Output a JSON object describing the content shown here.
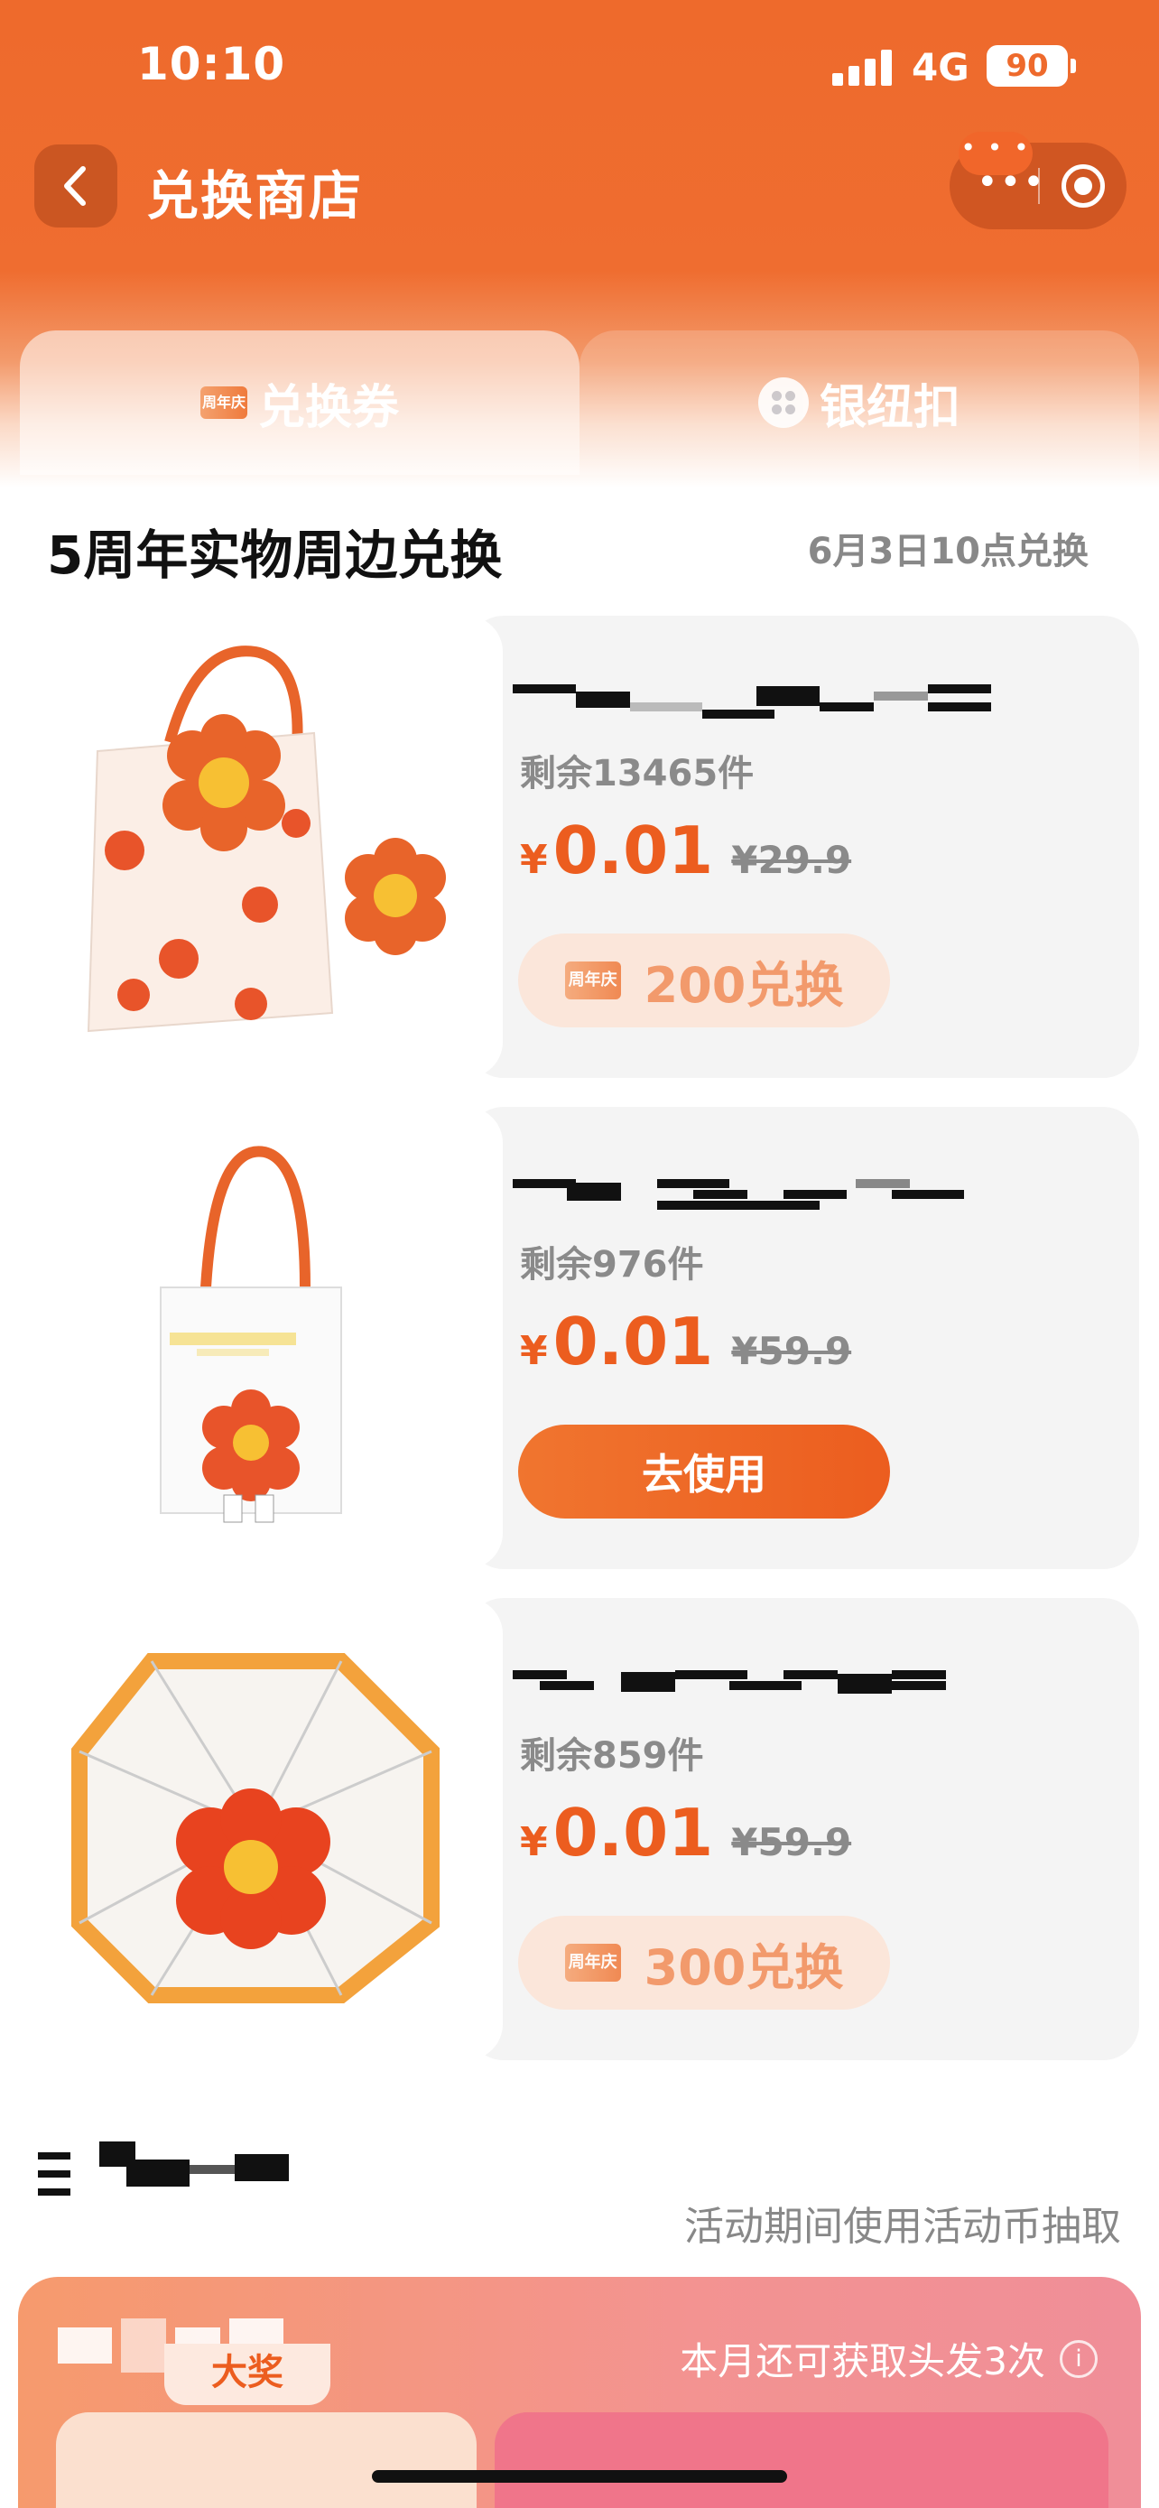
{
  "status_bar": {
    "time": "10:10",
    "network": "4G",
    "battery": "90"
  },
  "nav": {
    "title": "兑换商店",
    "capsule_dots": "•••",
    "notif": "• • •"
  },
  "tabs": [
    {
      "label": "兑换券",
      "icon_text": "周年庆"
    },
    {
      "label": "银纽扣"
    }
  ],
  "section": {
    "title": "5周年实物周边兑换",
    "note": "6月3日10点兑换"
  },
  "products": [
    {
      "stock": "剩余13465件",
      "price_symbol": "¥",
      "price": "0.01",
      "original_price": "¥29.9",
      "action_icon_text": "周年庆",
      "cost": "200兑换"
    },
    {
      "stock": "剩余976件",
      "price_symbol": "¥",
      "price": "0.01",
      "original_price": "¥59.9",
      "action_label": "去使用"
    },
    {
      "stock": "剩余859件",
      "price_symbol": "¥",
      "price": "0.01",
      "original_price": "¥59.9",
      "action_icon_text": "周年庆",
      "cost": "300兑换"
    }
  ],
  "section2": {
    "note": "活动期间使用活动币抽取"
  },
  "promo": {
    "note": "本月还可获取头发3次",
    "info_icon": "i",
    "prize_tag": "大奖"
  },
  "colors": {
    "brand_orange": "#ee6a2c",
    "price_red": "#ec5d1f",
    "card_bg": "#f4f4f4"
  }
}
